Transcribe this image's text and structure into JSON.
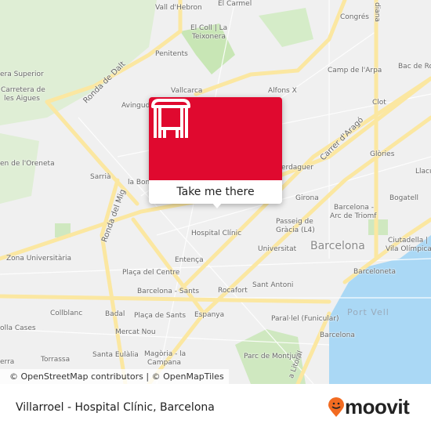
{
  "map": {
    "labels": [
      "Vall d'Hebron",
      "El Carmel",
      "Congrés",
      "El Coll | La",
      "Teixonera",
      "Penitents",
      "Camp de l'Arpa",
      "Bac de Roda",
      "era Superior",
      "Carretera de",
      "les Aigues",
      "Ronda de Dalt",
      "Vallcarca",
      "Alfons X",
      "Avingud",
      "Clot",
      "Carrer d'Aragó",
      "Glòries",
      "en de l'Oreneta",
      "Sarrià",
      "la Bon",
      "erdaguer",
      "Llacuna",
      "Girona",
      "Bogatell",
      "Ronda del Mig",
      "Barcelona -",
      "Arc de Triomf",
      "Passeig de",
      "Gràcia (L4)",
      "Hospital Clínic",
      "Universitat",
      "Barcelona",
      "Ciutadella |",
      "Vila Olímpica",
      "Zona Universitària",
      "Entença",
      "Plaça del Centre",
      "Barceloneta",
      "Sant Antoni",
      "Barcelona - Sants",
      "Rocafort",
      "Port Vell",
      "Collblanc",
      "Badal",
      "Plaça de Sants",
      "Espanya",
      "Paral·lel (Funicular)",
      "olla Cases",
      "Mercat Nou",
      "Barcelona",
      "Santa Eulàlia",
      "Torrassa",
      "erra",
      "Magòria - la",
      "Campana",
      "Parc de Montjuïc",
      "a Litoral",
      "diana"
    ],
    "attribution": "© OpenStreetMap contributors | © OpenMapTiles",
    "colors": {
      "land": "#f0f0f0",
      "road": "#fbe7a1",
      "park": "#cfe8c0",
      "sea": "#aad8f5",
      "popup": "#e0092f"
    }
  },
  "popup": {
    "icon": "bus-stop-icon",
    "action_label": "Take me there"
  },
  "footer": {
    "title": "Villarroel - Hospital Clínic, Barcelona",
    "logo_text": "moovit"
  }
}
